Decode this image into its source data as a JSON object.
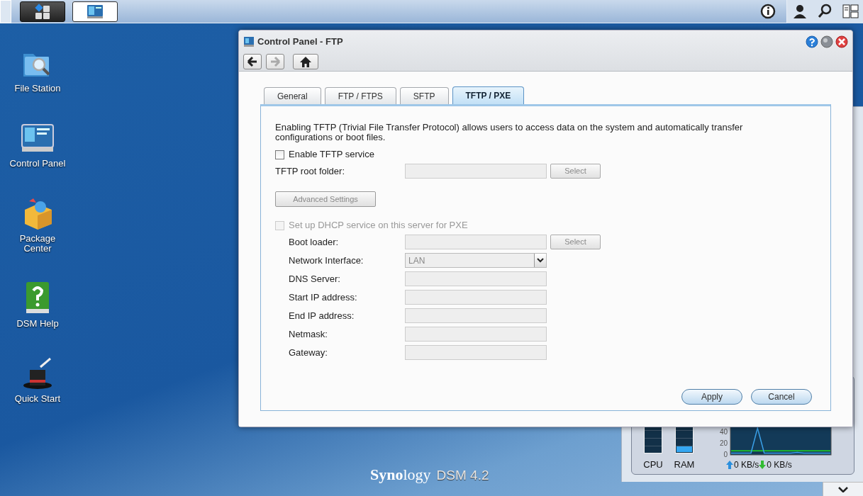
{
  "taskbar": {
    "buttons": [
      {
        "kind": "main-menu",
        "selected": false
      },
      {
        "kind": "control-panel",
        "selected": true
      }
    ],
    "right_icons": [
      {
        "kind": "info"
      },
      {
        "kind": "user"
      },
      {
        "kind": "search"
      },
      {
        "kind": "widgets"
      }
    ]
  },
  "desktop_icons": [
    {
      "kind": "folder",
      "label": "File Station"
    },
    {
      "kind": "panel",
      "label": "Control Panel"
    },
    {
      "kind": "package",
      "label": "Package Center"
    },
    {
      "kind": "help",
      "label": "DSM Help"
    },
    {
      "kind": "hat",
      "label": "Quick Start"
    }
  ],
  "branding": {
    "logo": "**Syno**logy",
    "version": "DSM 4.2"
  },
  "widget": {
    "meters": [
      {
        "label": "CPU",
        "level": 0
      },
      {
        "label": "RAM",
        "level": 0.2
      }
    ],
    "chart_data": {
      "type": "line",
      "yticks": [
        0,
        20,
        40
      ],
      "ylim": [
        0,
        55
      ],
      "series": [
        {
          "color": "#22dd22",
          "values": [
            6,
            6,
            6,
            6,
            6,
            6,
            6,
            6,
            6,
            6,
            6,
            6,
            6,
            6,
            6,
            6
          ]
        },
        {
          "color": "#3aa0e8",
          "values": [
            2,
            2,
            2,
            2,
            46,
            2,
            2,
            2,
            2,
            2,
            3,
            2,
            2,
            2,
            2,
            2
          ]
        }
      ]
    },
    "upload_rate": "0 KB/s",
    "download_rate": "0 KB/s"
  },
  "window": {
    "title": "Control Panel - FTP",
    "nav": [
      {
        "kind": "back",
        "disabled": false
      },
      {
        "kind": "forward",
        "disabled": true
      },
      {
        "kind": "home",
        "disabled": false
      }
    ],
    "tabs": [
      {
        "label": "General",
        "selected": false
      },
      {
        "label": "FTP / FTPS",
        "selected": false
      },
      {
        "label": "SFTP",
        "selected": false
      },
      {
        "label": "TFTP / PXE",
        "selected": true
      }
    ],
    "description": "Enabling TFTP (Trivial File Transfer Protocol) allows users to access data on the system and automatically transfer configurations or boot files.",
    "enable_tftp": {
      "label": "Enable TFTP service",
      "checked": false,
      "disabled": false
    },
    "root_folder": {
      "label": "TFTP root folder:",
      "button": "Select"
    },
    "advanced_button": "Advanced Settings",
    "dhcp": {
      "label": "Set up DHCP service on this server for PXE",
      "checked": false,
      "disabled": true
    },
    "fields": [
      {
        "kind": "text",
        "label": "Boot loader:",
        "button": "Select"
      },
      {
        "kind": "select",
        "label": "Network Interface:",
        "value": "LAN"
      },
      {
        "kind": "text",
        "label": "DNS Server:"
      },
      {
        "kind": "text",
        "label": "Start IP address:"
      },
      {
        "kind": "text",
        "label": "End IP address:"
      },
      {
        "kind": "text",
        "label": "Netmask:"
      },
      {
        "kind": "text",
        "label": "Gateway:"
      }
    ],
    "buttons": [
      "Apply",
      "Cancel"
    ]
  }
}
